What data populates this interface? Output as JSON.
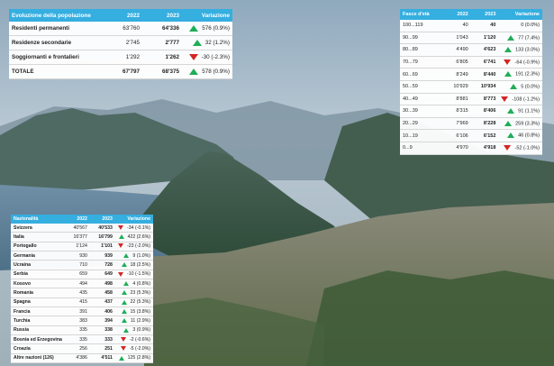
{
  "colors": {
    "header": "#35aee0",
    "up": "#1fae57",
    "down": "#d32626",
    "equal": "#35aee0"
  },
  "table_population": {
    "headers": [
      "Evoluzione della popolazione",
      "2022",
      "2023",
      "Variazione"
    ],
    "rows": [
      {
        "label": "Residenti permanenti",
        "y2022": "63'760",
        "y2023": "64'336",
        "trend": "up",
        "variation": "576 (0.9%)"
      },
      {
        "label": "Residenze secondarie",
        "y2022": "2'745",
        "y2023": "2'777",
        "trend": "up",
        "variation": "32 (1.2%)"
      },
      {
        "label": "Soggiornanti e frontalieri",
        "y2022": "1'292",
        "y2023": "1'262",
        "trend": "down",
        "variation": "-30 (-2.3%)"
      },
      {
        "label": "TOTALE",
        "y2022": "67'797",
        "y2023": "68'375",
        "trend": "up",
        "variation": "578 (0.9%)"
      }
    ]
  },
  "table_nationality": {
    "headers": [
      "Nazionalità",
      "2022",
      "2023",
      "Variazione"
    ],
    "rows": [
      {
        "label": "Svizzera",
        "y2022": "40'567",
        "y2023": "40'533",
        "trend": "down",
        "variation": "-34 (-0.1%)"
      },
      {
        "label": "Italia",
        "y2022": "16'377",
        "y2023": "16'799",
        "trend": "up",
        "variation": "422 (2.6%)"
      },
      {
        "label": "Portogallo",
        "y2022": "1'124",
        "y2023": "1'101",
        "trend": "down",
        "variation": "-23 (-2.0%)"
      },
      {
        "label": "Germania",
        "y2022": "930",
        "y2023": "939",
        "trend": "up",
        "variation": "9 (1.0%)"
      },
      {
        "label": "Ucraina",
        "y2022": "710",
        "y2023": "728",
        "trend": "up",
        "variation": "18 (2.5%)"
      },
      {
        "label": "Serbia",
        "y2022": "659",
        "y2023": "649",
        "trend": "down",
        "variation": "-10 (-1.5%)"
      },
      {
        "label": "Kosovo",
        "y2022": "494",
        "y2023": "498",
        "trend": "up",
        "variation": "4 (0.8%)"
      },
      {
        "label": "Romania",
        "y2022": "435",
        "y2023": "458",
        "trend": "up",
        "variation": "23 (5.3%)"
      },
      {
        "label": "Spagna",
        "y2022": "415",
        "y2023": "437",
        "trend": "up",
        "variation": "22 (5.3%)"
      },
      {
        "label": "Francia",
        "y2022": "391",
        "y2023": "406",
        "trend": "up",
        "variation": "15 (3.8%)"
      },
      {
        "label": "Turchia",
        "y2022": "383",
        "y2023": "394",
        "trend": "up",
        "variation": "11 (2.9%)"
      },
      {
        "label": "Russia",
        "y2022": "335",
        "y2023": "338",
        "trend": "up",
        "variation": "3 (0.9%)"
      },
      {
        "label": "Bosnia ed Erzegovina",
        "y2022": "335",
        "y2023": "333",
        "trend": "down",
        "variation": "-2 (-0.6%)"
      },
      {
        "label": "Croazia",
        "y2022": "256",
        "y2023": "251",
        "trend": "down",
        "variation": "-5 (-2.0%)"
      },
      {
        "label": "Altre nazioni (126)",
        "y2022": "4'386",
        "y2023": "4'511",
        "trend": "up",
        "variation": "125 (2.8%)"
      }
    ]
  },
  "table_age": {
    "headers": [
      "Fasce d'età",
      "2022",
      "2023",
      "Variazione"
    ],
    "rows": [
      {
        "label": "100...119",
        "y2022": "40",
        "y2023": "40",
        "trend": "equal",
        "variation": "0 (0.0%)"
      },
      {
        "label": "90...99",
        "y2022": "1'043",
        "y2023": "1'120",
        "trend": "up",
        "variation": "77 (7.4%)"
      },
      {
        "label": "80...89",
        "y2022": "4'490",
        "y2023": "4'623",
        "trend": "up",
        "variation": "133 (3.0%)"
      },
      {
        "label": "70...79",
        "y2022": "6'805",
        "y2023": "6'741",
        "trend": "down",
        "variation": "-64 (-0.9%)"
      },
      {
        "label": "60...69",
        "y2022": "8'249",
        "y2023": "8'440",
        "trend": "up",
        "variation": "191 (2.3%)"
      },
      {
        "label": "50...59",
        "y2022": "10'929",
        "y2023": "10'934",
        "trend": "up",
        "variation": "5 (0.0%)"
      },
      {
        "label": "40...49",
        "y2022": "8'881",
        "y2023": "8'773",
        "trend": "down",
        "variation": "-108 (-1.2%)"
      },
      {
        "label": "30...39",
        "y2022": "8'315",
        "y2023": "8'406",
        "trend": "up",
        "variation": "91 (1.1%)"
      },
      {
        "label": "20...29",
        "y2022": "7'969",
        "y2023": "8'228",
        "trend": "up",
        "variation": "259 (3.3%)"
      },
      {
        "label": "10...19",
        "y2022": "6'106",
        "y2023": "6'152",
        "trend": "up",
        "variation": "46 (0.8%)"
      },
      {
        "label": "0...9",
        "y2022": "4'970",
        "y2023": "4'918",
        "trend": "down",
        "variation": "-52 (-1.0%)"
      }
    ]
  }
}
